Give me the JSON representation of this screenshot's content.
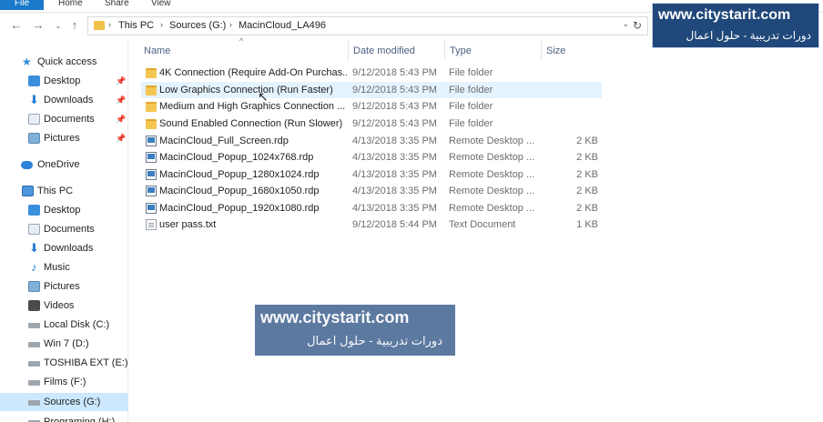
{
  "ribbon": {
    "tabs": [
      "File",
      "Home",
      "Share",
      "View"
    ]
  },
  "address": {
    "path": [
      "This PC",
      "Sources (G:)",
      "MacinCloud_LA496"
    ]
  },
  "watermark": {
    "url": "www.citystarit.com",
    "arabic": "دورات تدريبية - حلول اعمال"
  },
  "sidebar": {
    "quick_access": "Quick access",
    "quick_items": [
      {
        "label": "Desktop",
        "icon": "desktop-icon"
      },
      {
        "label": "Downloads",
        "icon": "downloads-icon"
      },
      {
        "label": "Documents",
        "icon": "documents-icon"
      },
      {
        "label": "Pictures",
        "icon": "pictures-icon"
      }
    ],
    "onedrive": "OneDrive",
    "this_pc": "This PC",
    "pc_items": [
      {
        "label": "Desktop",
        "icon": "desktop-icon"
      },
      {
        "label": "Documents",
        "icon": "documents-icon"
      },
      {
        "label": "Downloads",
        "icon": "downloads-icon"
      },
      {
        "label": "Music",
        "icon": "music-icon"
      },
      {
        "label": "Pictures",
        "icon": "pictures-icon"
      },
      {
        "label": "Videos",
        "icon": "videos-icon"
      },
      {
        "label": "Local Disk (C:)",
        "icon": "drive-icon"
      },
      {
        "label": "Win 7 (D:)",
        "icon": "drive-icon"
      },
      {
        "label": "TOSHIBA EXT (E:)",
        "icon": "drive-icon"
      },
      {
        "label": "Films (F:)",
        "icon": "drive-icon"
      },
      {
        "label": "Sources (G:)",
        "icon": "drive-icon"
      },
      {
        "label": "Programing (H:)",
        "icon": "drive-icon"
      }
    ]
  },
  "columns": {
    "name": "Name",
    "date": "Date modified",
    "type": "Type",
    "size": "Size"
  },
  "files": [
    {
      "name": "4K Connection (Require Add-On Purchas...",
      "date": "9/12/2018 5:43 PM",
      "type": "File folder",
      "size": "",
      "kind": "folder"
    },
    {
      "name": "Low Graphics Connection (Run Faster)",
      "date": "9/12/2018 5:43 PM",
      "type": "File folder",
      "size": "",
      "kind": "folder"
    },
    {
      "name": "Medium and High Graphics Connection ...",
      "date": "9/12/2018 5:43 PM",
      "type": "File folder",
      "size": "",
      "kind": "folder"
    },
    {
      "name": "Sound Enabled Connection (Run Slower)",
      "date": "9/12/2018 5:43 PM",
      "type": "File folder",
      "size": "",
      "kind": "folder"
    },
    {
      "name": "MacinCloud_Full_Screen.rdp",
      "date": "4/13/2018 3:35 PM",
      "type": "Remote Desktop ...",
      "size": "2 KB",
      "kind": "rdp"
    },
    {
      "name": "MacinCloud_Popup_1024x768.rdp",
      "date": "4/13/2018 3:35 PM",
      "type": "Remote Desktop ...",
      "size": "2 KB",
      "kind": "rdp"
    },
    {
      "name": "MacinCloud_Popup_1280x1024.rdp",
      "date": "4/13/2018 3:35 PM",
      "type": "Remote Desktop ...",
      "size": "2 KB",
      "kind": "rdp"
    },
    {
      "name": "MacinCloud_Popup_1680x1050.rdp",
      "date": "4/13/2018 3:35 PM",
      "type": "Remote Desktop ...",
      "size": "2 KB",
      "kind": "rdp"
    },
    {
      "name": "MacinCloud_Popup_1920x1080.rdp",
      "date": "4/13/2018 3:35 PM",
      "type": "Remote Desktop ...",
      "size": "2 KB",
      "kind": "rdp"
    },
    {
      "name": "user pass.txt",
      "date": "9/12/2018 5:44 PM",
      "type": "Text Document",
      "size": "1 KB",
      "kind": "txt"
    }
  ]
}
